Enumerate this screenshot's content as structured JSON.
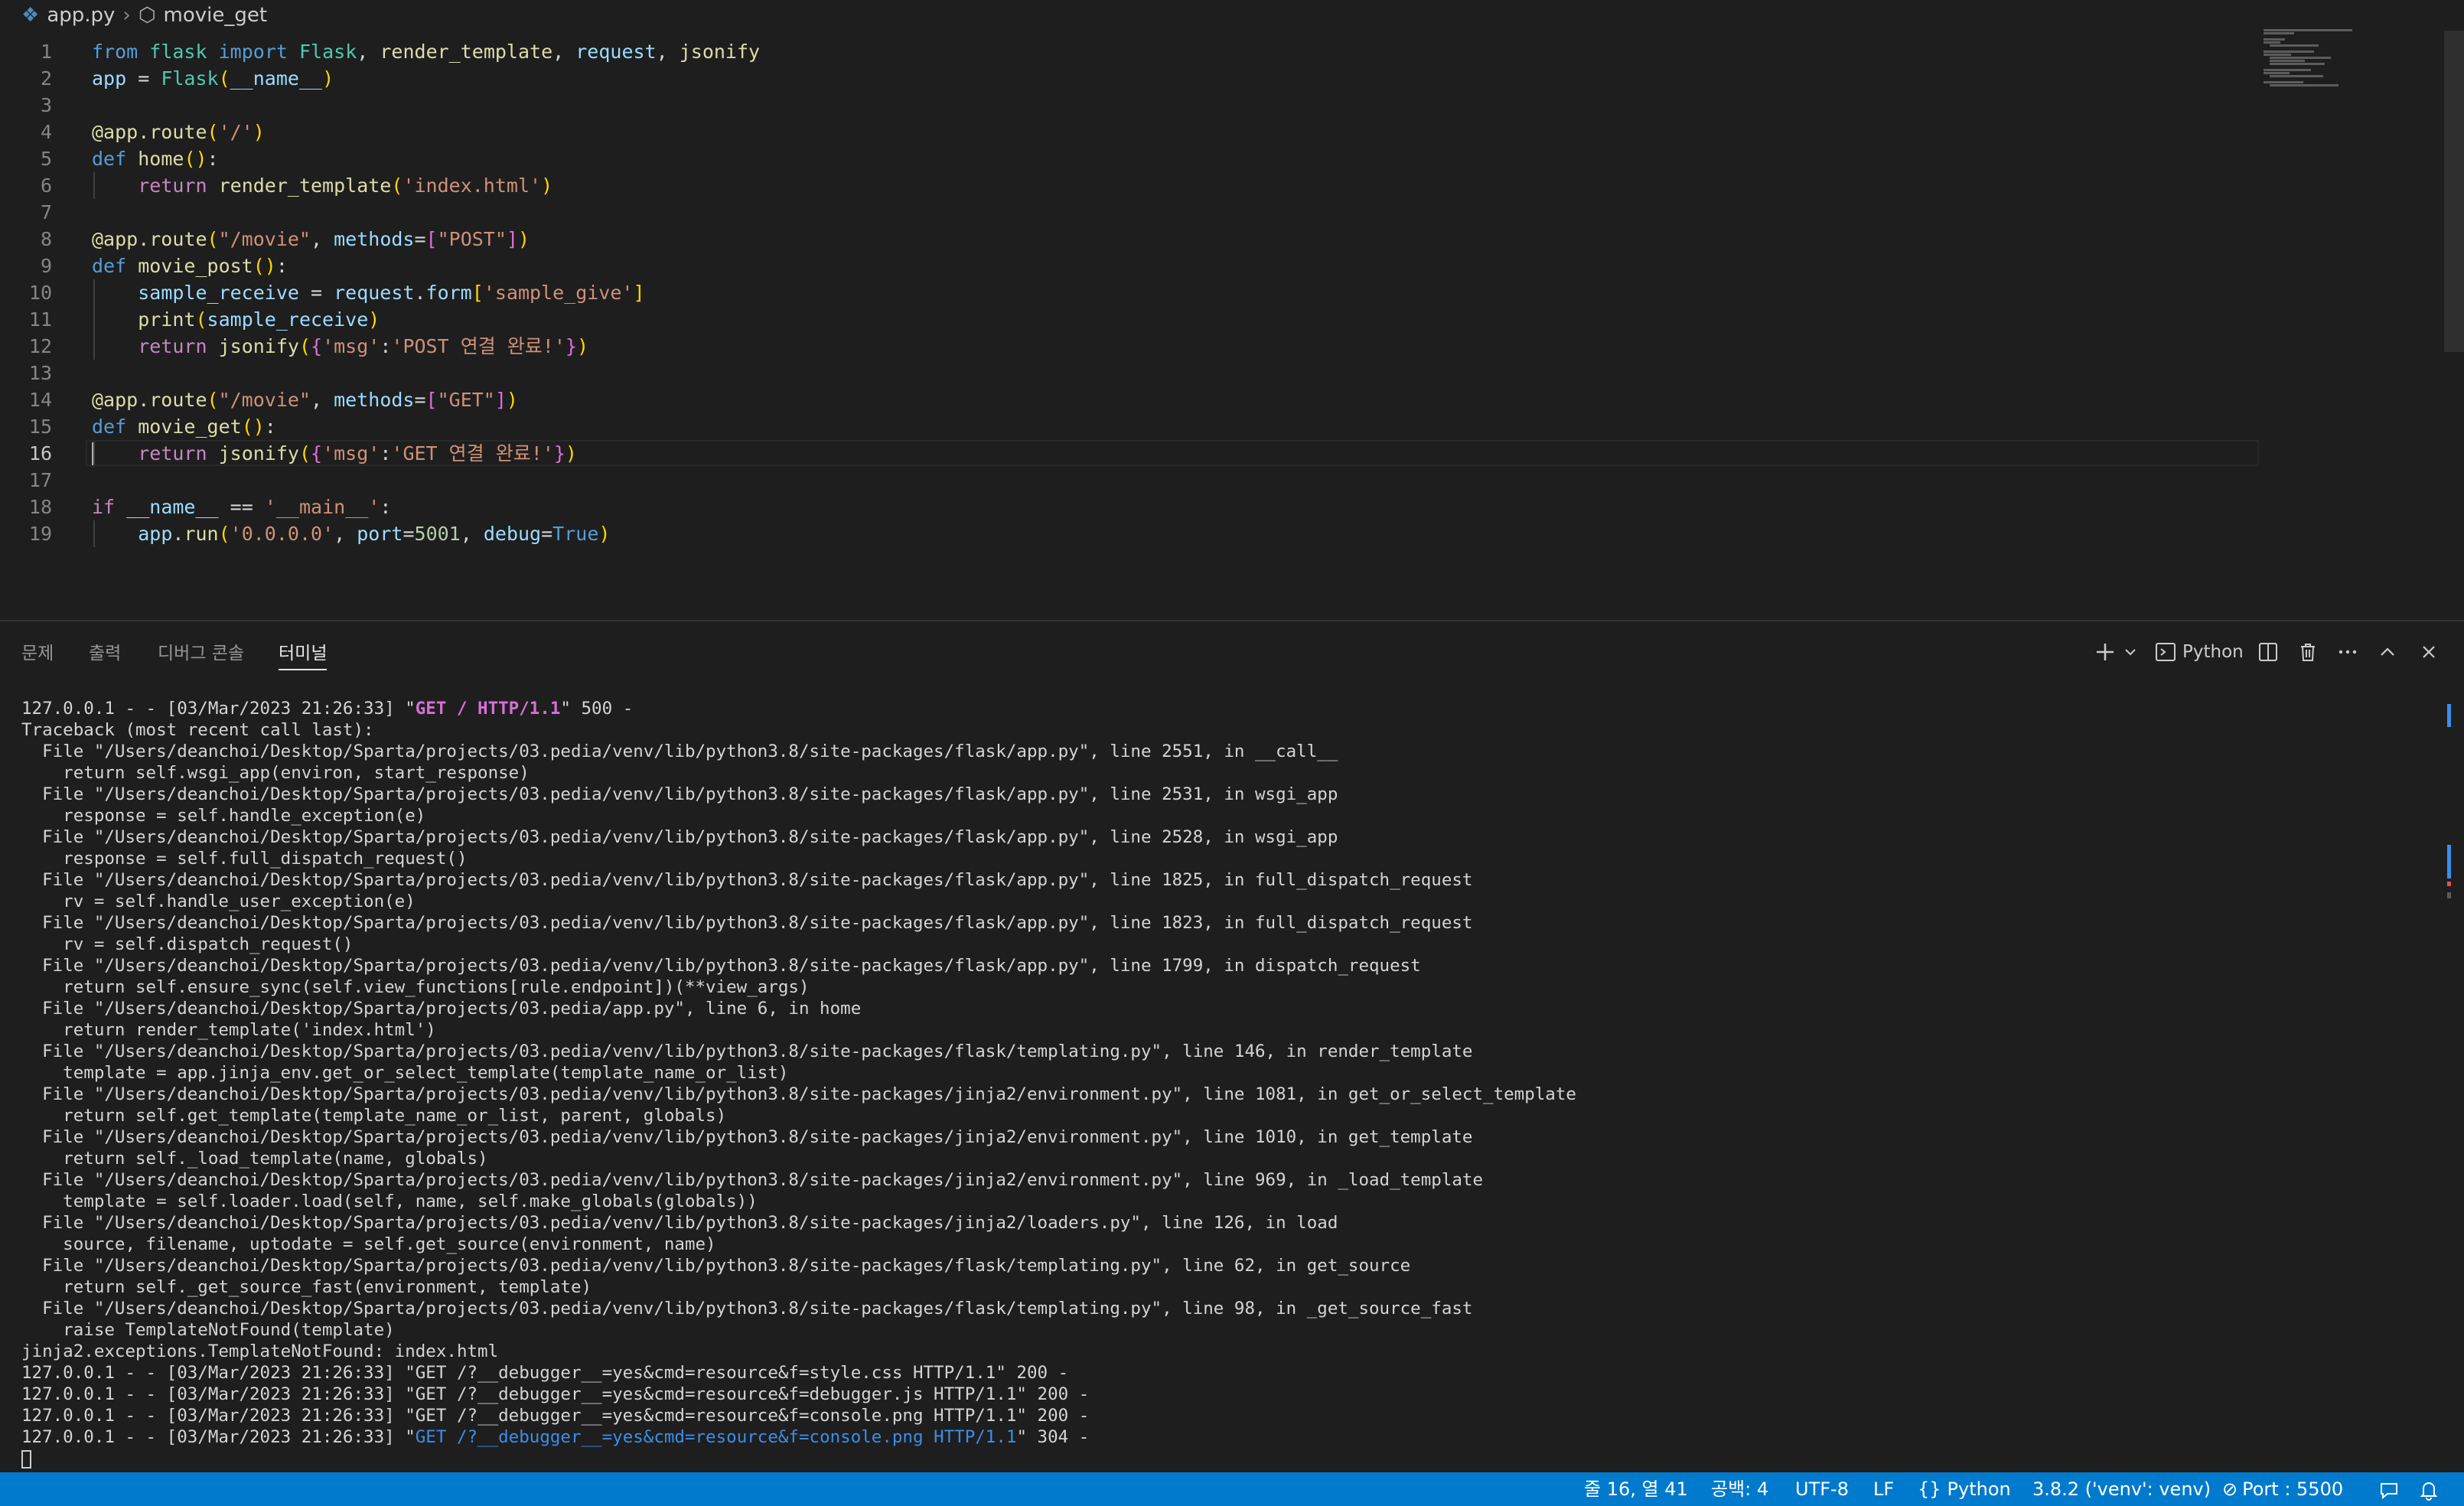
{
  "breadcrumb": {
    "file": "app.py",
    "symbol": "movie_get"
  },
  "editor": {
    "active_line": 16,
    "lines": [
      {
        "n": "1",
        "tokens": [
          [
            "kw",
            "from"
          ],
          [
            "plain",
            " "
          ],
          [
            "cls",
            "flask"
          ],
          [
            "plain",
            " "
          ],
          [
            "kw",
            "import"
          ],
          [
            "plain",
            " "
          ],
          [
            "cls",
            "Flask"
          ],
          [
            "plain",
            ", "
          ],
          [
            "fn",
            "render_template"
          ],
          [
            "plain",
            ", "
          ],
          [
            "var",
            "request"
          ],
          [
            "plain",
            ", "
          ],
          [
            "fn",
            "jsonify"
          ]
        ]
      },
      {
        "n": "2",
        "tokens": [
          [
            "var",
            "app"
          ],
          [
            "plain",
            " = "
          ],
          [
            "cls",
            "Flask"
          ],
          [
            "br1",
            "("
          ],
          [
            "var",
            "__name__"
          ],
          [
            "br1",
            ")"
          ]
        ]
      },
      {
        "n": "3",
        "tokens": []
      },
      {
        "n": "4",
        "tokens": [
          [
            "fn",
            "@app.route"
          ],
          [
            "br1",
            "("
          ],
          [
            "str",
            "'/'"
          ],
          [
            "br1",
            ")"
          ]
        ]
      },
      {
        "n": "5",
        "tokens": [
          [
            "kw",
            "def"
          ],
          [
            "plain",
            " "
          ],
          [
            "fn",
            "home"
          ],
          [
            "br1",
            "()"
          ],
          [
            "plain",
            ":"
          ]
        ]
      },
      {
        "n": "6",
        "tokens": [
          [
            "plain",
            "    "
          ],
          [
            "ctl",
            "return"
          ],
          [
            "plain",
            " "
          ],
          [
            "fn",
            "render_template"
          ],
          [
            "br1",
            "("
          ],
          [
            "str",
            "'index.html'"
          ],
          [
            "br1",
            ")"
          ]
        ]
      },
      {
        "n": "7",
        "tokens": []
      },
      {
        "n": "8",
        "tokens": [
          [
            "fn",
            "@app.route"
          ],
          [
            "br1",
            "("
          ],
          [
            "str",
            "\"/movie\""
          ],
          [
            "plain",
            ", "
          ],
          [
            "var",
            "methods"
          ],
          [
            "plain",
            "="
          ],
          [
            "br2",
            "["
          ],
          [
            "str",
            "\"POST\""
          ],
          [
            "br2",
            "]"
          ],
          [
            "br1",
            ")"
          ]
        ]
      },
      {
        "n": "9",
        "tokens": [
          [
            "kw",
            "def"
          ],
          [
            "plain",
            " "
          ],
          [
            "fn",
            "movie_post"
          ],
          [
            "br1",
            "()"
          ],
          [
            "plain",
            ":"
          ]
        ]
      },
      {
        "n": "10",
        "tokens": [
          [
            "plain",
            "    "
          ],
          [
            "var",
            "sample_receive"
          ],
          [
            "plain",
            " = "
          ],
          [
            "var",
            "request"
          ],
          [
            "plain",
            "."
          ],
          [
            "var",
            "form"
          ],
          [
            "br1",
            "["
          ],
          [
            "str",
            "'sample_give'"
          ],
          [
            "br1",
            "]"
          ]
        ]
      },
      {
        "n": "11",
        "tokens": [
          [
            "plain",
            "    "
          ],
          [
            "fn",
            "print"
          ],
          [
            "br1",
            "("
          ],
          [
            "var",
            "sample_receive"
          ],
          [
            "br1",
            ")"
          ]
        ]
      },
      {
        "n": "12",
        "tokens": [
          [
            "plain",
            "    "
          ],
          [
            "ctl",
            "return"
          ],
          [
            "plain",
            " "
          ],
          [
            "fn",
            "jsonify"
          ],
          [
            "br1",
            "("
          ],
          [
            "br2",
            "{"
          ],
          [
            "str",
            "'msg'"
          ],
          [
            "plain",
            ":"
          ],
          [
            "str",
            "'POST 연결 완료!'"
          ],
          [
            "br2",
            "}"
          ],
          [
            "br1",
            ")"
          ]
        ]
      },
      {
        "n": "13",
        "tokens": []
      },
      {
        "n": "14",
        "tokens": [
          [
            "fn",
            "@app.route"
          ],
          [
            "br1",
            "("
          ],
          [
            "str",
            "\"/movie\""
          ],
          [
            "plain",
            ", "
          ],
          [
            "var",
            "methods"
          ],
          [
            "plain",
            "="
          ],
          [
            "br2",
            "["
          ],
          [
            "str",
            "\"GET\""
          ],
          [
            "br2",
            "]"
          ],
          [
            "br1",
            ")"
          ]
        ]
      },
      {
        "n": "15",
        "tokens": [
          [
            "kw",
            "def"
          ],
          [
            "plain",
            " "
          ],
          [
            "fn",
            "movie_get"
          ],
          [
            "br1",
            "()"
          ],
          [
            "plain",
            ":"
          ]
        ]
      },
      {
        "n": "16",
        "tokens": [
          [
            "plain",
            "    "
          ],
          [
            "ctl",
            "return"
          ],
          [
            "plain",
            " "
          ],
          [
            "fn",
            "jsonify"
          ],
          [
            "br1",
            "("
          ],
          [
            "br2",
            "{"
          ],
          [
            "str",
            "'msg'"
          ],
          [
            "plain",
            ":"
          ],
          [
            "str",
            "'GET 연결 완료!'"
          ],
          [
            "br2",
            "}"
          ],
          [
            "br1",
            ")"
          ]
        ]
      },
      {
        "n": "17",
        "tokens": []
      },
      {
        "n": "18",
        "tokens": [
          [
            "ctl",
            "if"
          ],
          [
            "plain",
            " "
          ],
          [
            "var",
            "__name__"
          ],
          [
            "plain",
            " == "
          ],
          [
            "str",
            "'__main__'"
          ],
          [
            "plain",
            ":"
          ]
        ]
      },
      {
        "n": "19",
        "tokens": [
          [
            "plain",
            "    "
          ],
          [
            "var",
            "app"
          ],
          [
            "plain",
            "."
          ],
          [
            "fn",
            "run"
          ],
          [
            "br1",
            "("
          ],
          [
            "str",
            "'0.0.0.0'"
          ],
          [
            "plain",
            ", "
          ],
          [
            "var",
            "port"
          ],
          [
            "plain",
            "="
          ],
          [
            "num",
            "5001"
          ],
          [
            "plain",
            ", "
          ],
          [
            "var",
            "debug"
          ],
          [
            "plain",
            "="
          ],
          [
            "kw",
            "True"
          ],
          [
            "br1",
            ")"
          ]
        ]
      }
    ]
  },
  "panel": {
    "tabs": [
      {
        "label": "문제",
        "active": false
      },
      {
        "label": "출력",
        "active": false
      },
      {
        "label": "디버그 콘솔",
        "active": false
      },
      {
        "label": "터미널",
        "active": true
      }
    ],
    "terminal_profile": "Python"
  },
  "terminal": {
    "lines": [
      [
        [
          "plain",
          "127.0.0.1 - - [03/Mar/2023 21:26:33] \""
        ],
        [
          "magenta",
          "GET / HTTP/1.1"
        ],
        [
          "plain",
          "\" 500 -"
        ]
      ],
      [
        [
          "plain",
          "Traceback (most recent call last):"
        ]
      ],
      [
        [
          "plain",
          "  File \"/Users/deanchoi/Desktop/Sparta/projects/03.pedia/venv/lib/python3.8/site-packages/flask/app.py\", line 2551, in __call__"
        ]
      ],
      [
        [
          "plain",
          "    return self.wsgi_app(environ, start_response)"
        ]
      ],
      [
        [
          "plain",
          "  File \"/Users/deanchoi/Desktop/Sparta/projects/03.pedia/venv/lib/python3.8/site-packages/flask/app.py\", line 2531, in wsgi_app"
        ]
      ],
      [
        [
          "plain",
          "    response = self.handle_exception(e)"
        ]
      ],
      [
        [
          "plain",
          "  File \"/Users/deanchoi/Desktop/Sparta/projects/03.pedia/venv/lib/python3.8/site-packages/flask/app.py\", line 2528, in wsgi_app"
        ]
      ],
      [
        [
          "plain",
          "    response = self.full_dispatch_request()"
        ]
      ],
      [
        [
          "plain",
          "  File \"/Users/deanchoi/Desktop/Sparta/projects/03.pedia/venv/lib/python3.8/site-packages/flask/app.py\", line 1825, in full_dispatch_request"
        ]
      ],
      [
        [
          "plain",
          "    rv = self.handle_user_exception(e)"
        ]
      ],
      [
        [
          "plain",
          "  File \"/Users/deanchoi/Desktop/Sparta/projects/03.pedia/venv/lib/python3.8/site-packages/flask/app.py\", line 1823, in full_dispatch_request"
        ]
      ],
      [
        [
          "plain",
          "    rv = self.dispatch_request()"
        ]
      ],
      [
        [
          "plain",
          "  File \"/Users/deanchoi/Desktop/Sparta/projects/03.pedia/venv/lib/python3.8/site-packages/flask/app.py\", line 1799, in dispatch_request"
        ]
      ],
      [
        [
          "plain",
          "    return self.ensure_sync(self.view_functions[rule.endpoint])(**view_args)"
        ]
      ],
      [
        [
          "plain",
          "  File \"/Users/deanchoi/Desktop/Sparta/projects/03.pedia/app.py\", line 6, in home"
        ]
      ],
      [
        [
          "plain",
          "    return render_template('index.html')"
        ]
      ],
      [
        [
          "plain",
          "  File \"/Users/deanchoi/Desktop/Sparta/projects/03.pedia/venv/lib/python3.8/site-packages/flask/templating.py\", line 146, in render_template"
        ]
      ],
      [
        [
          "plain",
          "    template = app.jinja_env.get_or_select_template(template_name_or_list)"
        ]
      ],
      [
        [
          "plain",
          "  File \"/Users/deanchoi/Desktop/Sparta/projects/03.pedia/venv/lib/python3.8/site-packages/jinja2/environment.py\", line 1081, in get_or_select_template"
        ]
      ],
      [
        [
          "plain",
          "    return self.get_template(template_name_or_list, parent, globals)"
        ]
      ],
      [
        [
          "plain",
          "  File \"/Users/deanchoi/Desktop/Sparta/projects/03.pedia/venv/lib/python3.8/site-packages/jinja2/environment.py\", line 1010, in get_template"
        ]
      ],
      [
        [
          "plain",
          "    return self._load_template(name, globals)"
        ]
      ],
      [
        [
          "plain",
          "  File \"/Users/deanchoi/Desktop/Sparta/projects/03.pedia/venv/lib/python3.8/site-packages/jinja2/environment.py\", line 969, in _load_template"
        ]
      ],
      [
        [
          "plain",
          "    template = self.loader.load(self, name, self.make_globals(globals))"
        ]
      ],
      [
        [
          "plain",
          "  File \"/Users/deanchoi/Desktop/Sparta/projects/03.pedia/venv/lib/python3.8/site-packages/jinja2/loaders.py\", line 126, in load"
        ]
      ],
      [
        [
          "plain",
          "    source, filename, uptodate = self.get_source(environment, name)"
        ]
      ],
      [
        [
          "plain",
          "  File \"/Users/deanchoi/Desktop/Sparta/projects/03.pedia/venv/lib/python3.8/site-packages/flask/templating.py\", line 62, in get_source"
        ]
      ],
      [
        [
          "plain",
          "    return self._get_source_fast(environment, template)"
        ]
      ],
      [
        [
          "plain",
          "  File \"/Users/deanchoi/Desktop/Sparta/projects/03.pedia/venv/lib/python3.8/site-packages/flask/templating.py\", line 98, in _get_source_fast"
        ]
      ],
      [
        [
          "plain",
          "    raise TemplateNotFound(template)"
        ]
      ],
      [
        [
          "plain",
          "jinja2.exceptions.TemplateNotFound: index.html"
        ]
      ],
      [
        [
          "plain",
          "127.0.0.1 - - [03/Mar/2023 21:26:33] \"GET /?__debugger__=yes&cmd=resource&f=style.css HTTP/1.1\" 200 -"
        ]
      ],
      [
        [
          "plain",
          "127.0.0.1 - - [03/Mar/2023 21:26:33] \"GET /?__debugger__=yes&cmd=resource&f=debugger.js HTTP/1.1\" 200 -"
        ]
      ],
      [
        [
          "plain",
          "127.0.0.1 - - [03/Mar/2023 21:26:33] \"GET /?__debugger__=yes&cmd=resource&f=console.png HTTP/1.1\" 200 -"
        ]
      ],
      [
        [
          "plain",
          "127.0.0.1 - - [03/Mar/2023 21:26:33] \""
        ],
        [
          "blue",
          "GET /?__debugger__=yes&cmd=resource&f=console.png HTTP/1.1"
        ],
        [
          "plain",
          "\" 304 -"
        ]
      ]
    ]
  },
  "status": {
    "position": "줄 16, 열 41",
    "indent": "공백: 4",
    "encoding": "UTF-8",
    "eol": "LF",
    "language": "Python",
    "interpreter": "3.8.2 ('venv': venv)",
    "port": "Port : 5500",
    "colors": {
      "statusbar": "#007acc"
    }
  },
  "icons": [
    "python-file-icon",
    "symbol-method-icon",
    "plus-icon",
    "chevron-down-icon",
    "terminal-icon",
    "split-icon",
    "trash-icon",
    "more-icon",
    "chevron-up-icon",
    "close-icon",
    "python-braces-icon",
    "no-entry-icon",
    "feedback-icon",
    "bell-icon"
  ]
}
